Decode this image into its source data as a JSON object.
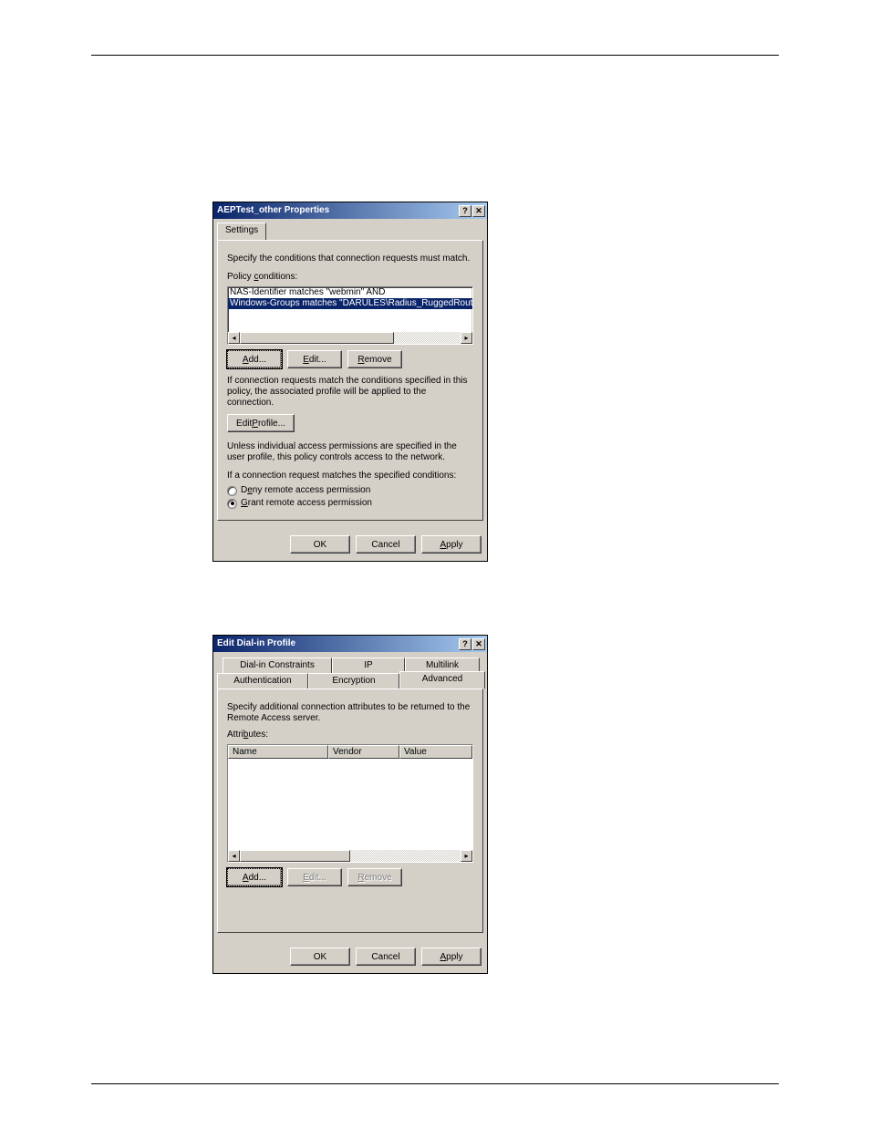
{
  "dialog1": {
    "title": "AEPTest_other Properties",
    "tab_settings": "Settings",
    "specify_conditions": "Specify the conditions that connection requests must match.",
    "policy_conditions_label": "Policy conditions:",
    "conditions": [
      "NAS-Identifier matches \"webmin\"  AND",
      "Windows-Groups matches \"DARULES\\Radius_RuggedRouter_root\""
    ],
    "btn_add": "Add...",
    "btn_edit": "Edit...",
    "btn_remove": "Remove",
    "match_text": "If connection requests match the conditions specified in this policy, the associated profile will be applied to the connection.",
    "btn_edit_profile": "Edit Profile...",
    "unless_text": "Unless individual access permissions are specified in the user profile, this policy controls access to the network.",
    "if_match_text": "If a connection request matches the specified conditions:",
    "radio_deny": "Deny remote access permission",
    "radio_grant": "Grant remote access permission",
    "btn_ok": "OK",
    "btn_cancel": "Cancel",
    "btn_apply": "Apply"
  },
  "dialog2": {
    "title": "Edit Dial-in Profile",
    "tabs_top": {
      "dialin": "Dial-in Constraints",
      "ip": "IP",
      "multilink": "Multilink"
    },
    "tabs_bottom": {
      "auth": "Authentication",
      "encryption": "Encryption",
      "advanced": "Advanced"
    },
    "specify_text": "Specify additional connection attributes to be returned to the Remote Access server.",
    "attributes_label": "Attributes:",
    "cols": {
      "name": "Name",
      "vendor": "Vendor",
      "value": "Value"
    },
    "btn_add": "Add...",
    "btn_edit": "Edit...",
    "btn_remove": "Remove",
    "btn_ok": "OK",
    "btn_cancel": "Cancel",
    "btn_apply": "Apply"
  }
}
